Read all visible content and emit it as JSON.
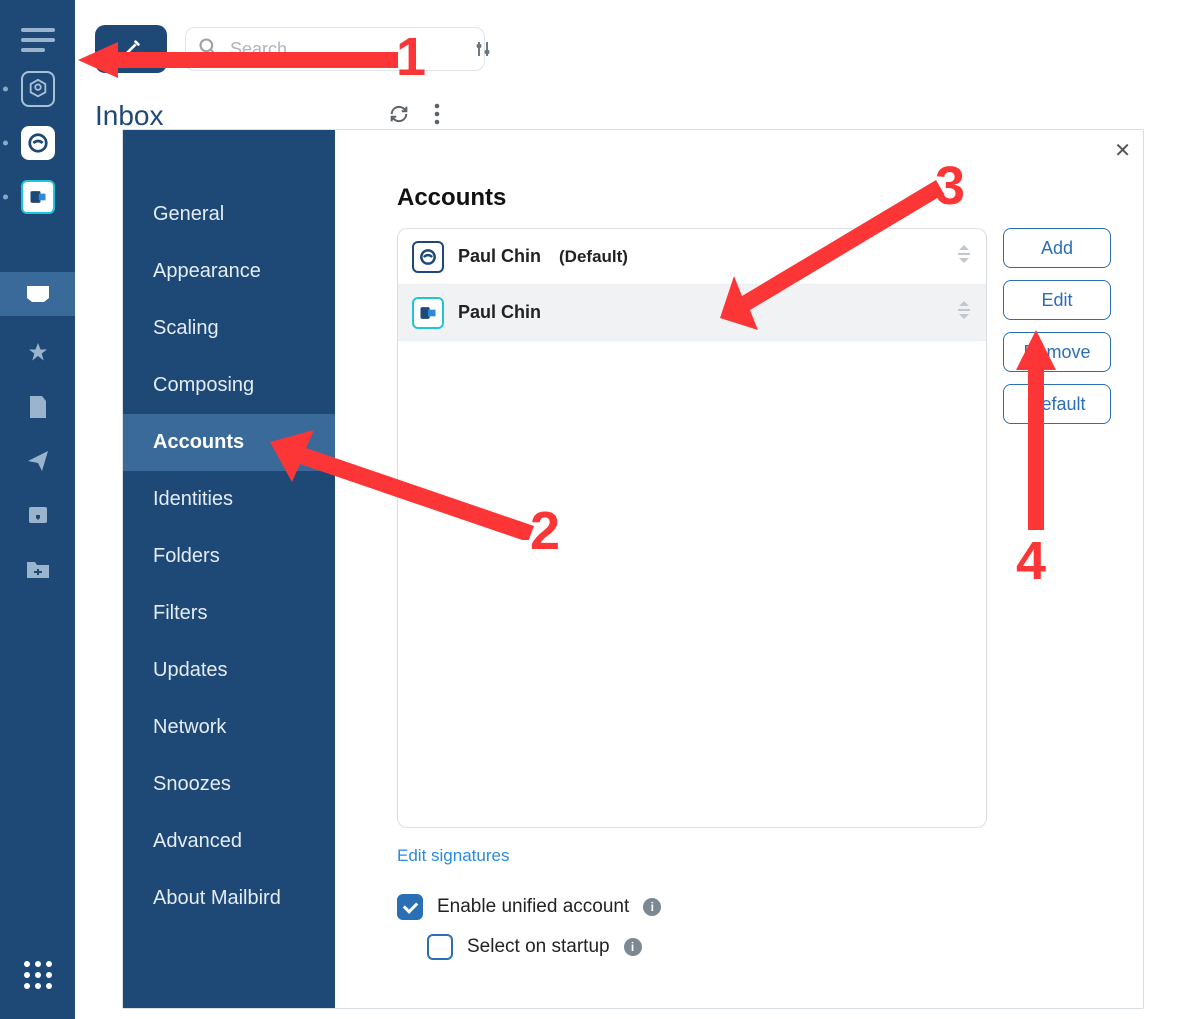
{
  "topbar": {
    "search_placeholder": "Search",
    "inbox_label": "Inbox"
  },
  "settings": {
    "nav": [
      "General",
      "Appearance",
      "Scaling",
      "Composing",
      "Accounts",
      "Identities",
      "Folders",
      "Filters",
      "Updates",
      "Network",
      "Snoozes",
      "Advanced",
      "About Mailbird"
    ],
    "active_nav_index": 4,
    "title": "Accounts",
    "accounts": [
      {
        "name": "Paul Chin",
        "tag": "(Default)",
        "provider": "mailbird",
        "selected": false
      },
      {
        "name": "Paul Chin",
        "tag": "",
        "provider": "outlook",
        "selected": true
      }
    ],
    "buttons": {
      "add": "Add",
      "edit": "Edit",
      "remove": "Remove",
      "default": "Default"
    },
    "edit_signatures": "Edit signatures",
    "options": {
      "unified": {
        "label": "Enable unified account",
        "checked": true
      },
      "startup": {
        "label": "Select on startup",
        "checked": false
      }
    }
  },
  "annotations": {
    "one": "1",
    "two": "2",
    "three": "3",
    "four": "4"
  },
  "colors": {
    "brand": "#1e4976",
    "accent": "#2a6fb5",
    "anno": "#fc3636"
  }
}
